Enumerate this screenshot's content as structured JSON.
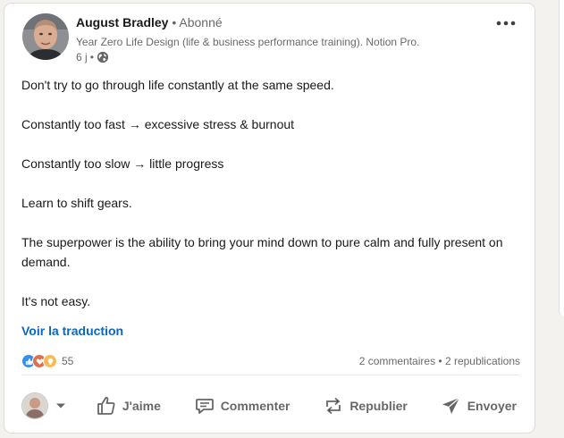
{
  "post": {
    "author": {
      "name": "August Bradley",
      "separator": "•",
      "status": "Abonné",
      "headline": "Year Zero Life Design (life & business performance training). Notion Pro.",
      "time": "6 j",
      "time_separator": "•"
    },
    "body": [
      "Don't try to go through life constantly at the same speed.",
      "Constantly too fast → excessive stress & burnout",
      "Constantly too slow → little progress",
      "Learn to shift gears.",
      "The superpower is the ability to bring your mind down to pure calm and fully present on demand.",
      "It's not easy."
    ],
    "translate_label": "Voir la traduction",
    "reactions": {
      "count": "55",
      "icons": [
        "like-icon",
        "love-icon",
        "insightful-icon"
      ]
    },
    "counts": "2 commentaires • 2 republications"
  },
  "actions": {
    "like": "J'aime",
    "comment": "Commenter",
    "repost": "Republier",
    "send": "Envoyer"
  },
  "colors": {
    "link": "#0a66c2",
    "like": "#378fe9",
    "love": "#df704d",
    "insightful": "#f5bb5c"
  }
}
